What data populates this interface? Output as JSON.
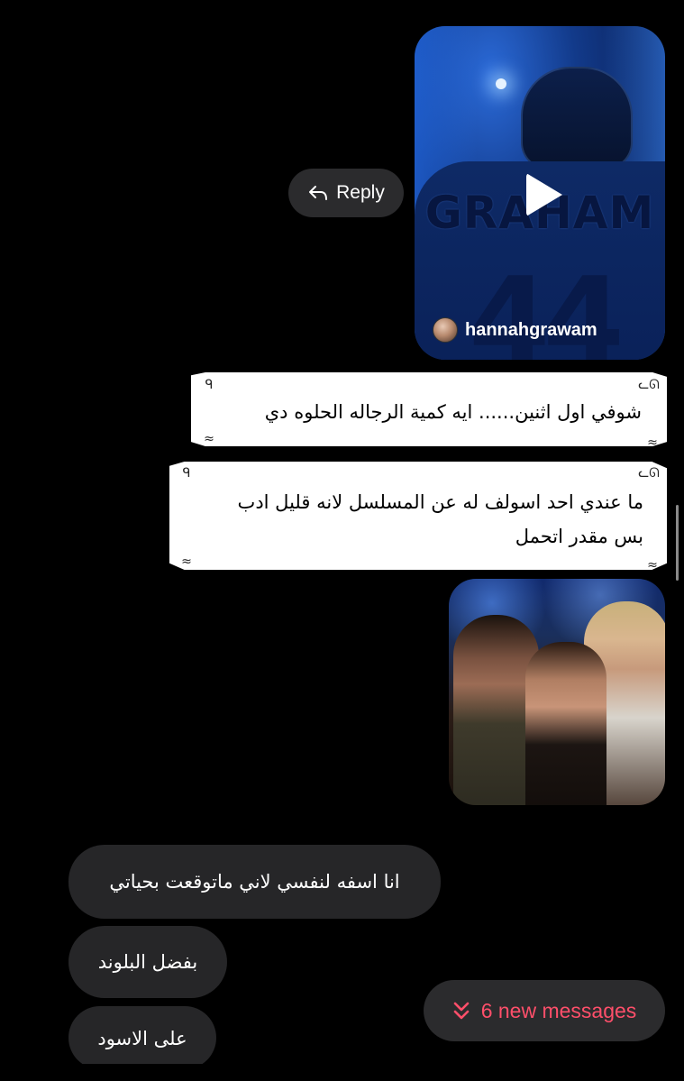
{
  "video_message": {
    "jersey_name": "GRAHAM",
    "jersey_number": "44",
    "author": "hannahgrawam"
  },
  "reply_button": {
    "label": "Reply"
  },
  "sent_messages": [
    {
      "text": "شوفي اول اثنين...... ايه كمية الرجاله الحلوه دي"
    },
    {
      "line1": "ما عندي احد اسولف له عن المسلسل لانه قليل ادب",
      "line2": "بس مقدر اتحمل"
    }
  ],
  "received_messages": [
    {
      "text": "انا اسفه لنفسي لاني ماتوقعت بحياتي"
    },
    {
      "text": "بفضل البلوند"
    },
    {
      "text": "على الاسود"
    }
  ],
  "new_messages_pill": {
    "label": "6 new messages",
    "accent_color": "#ff4f6a"
  }
}
